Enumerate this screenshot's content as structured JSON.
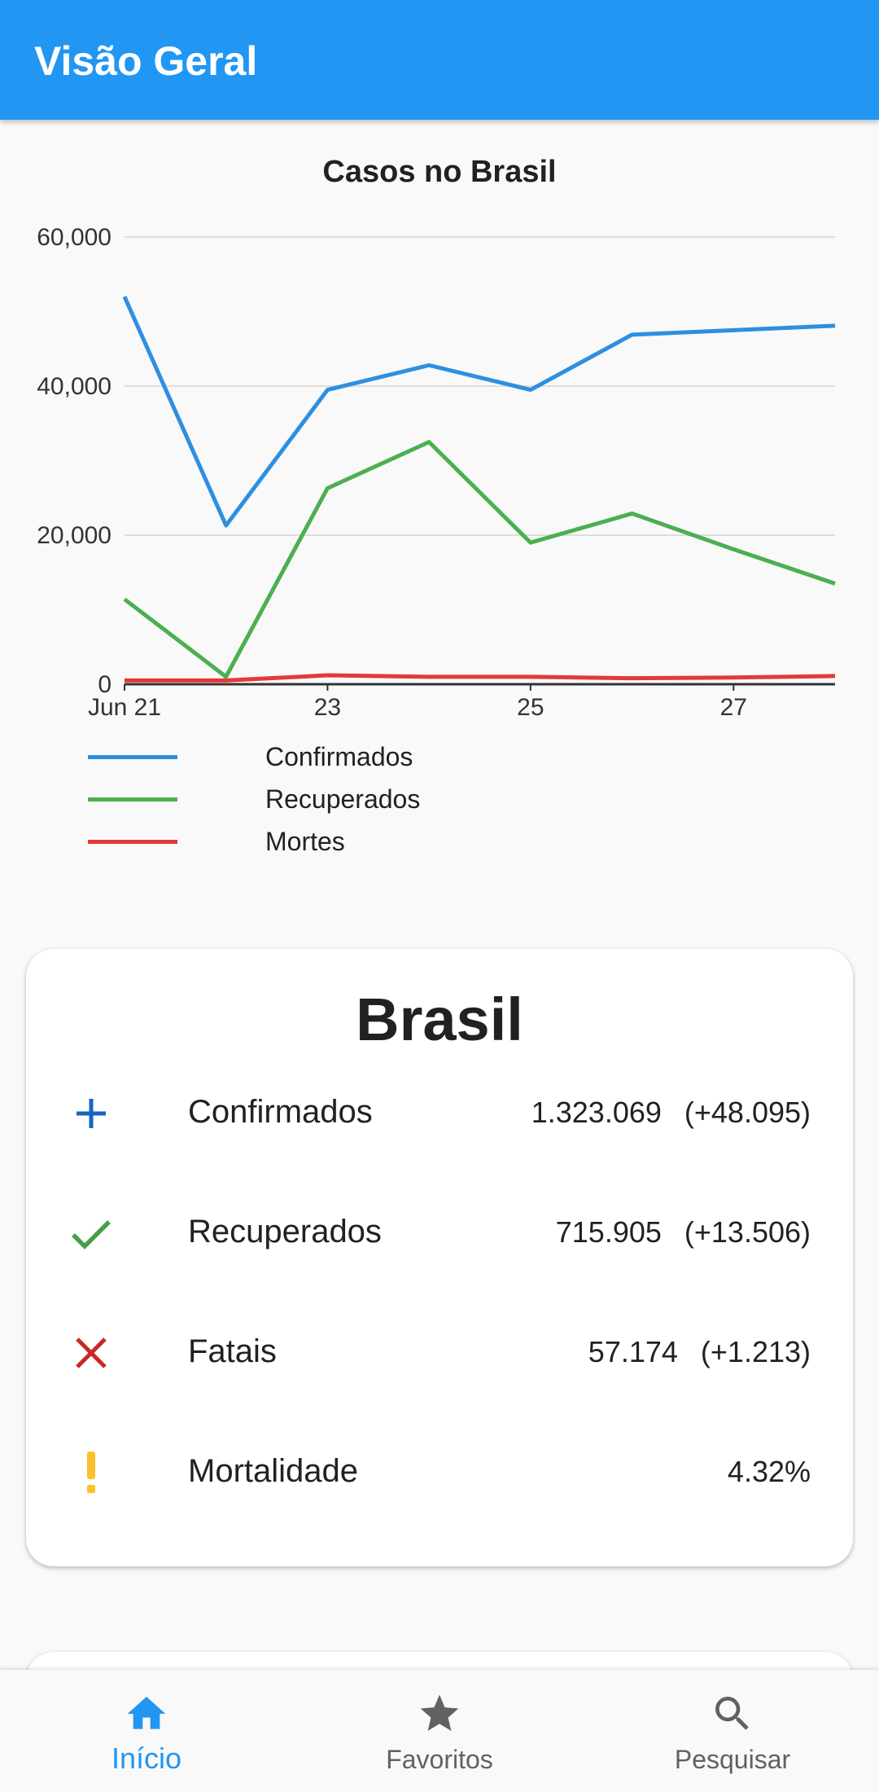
{
  "appbar": {
    "title": "Visão Geral"
  },
  "chart_section": {
    "title": "Casos no Brasil"
  },
  "chart_data": {
    "type": "line",
    "title": "Casos no Brasil",
    "x": [
      "Jun 21",
      "22",
      "23",
      "24",
      "25",
      "26",
      "27",
      "28"
    ],
    "x_tick_labels": [
      "Jun 21",
      "23",
      "25",
      "27"
    ],
    "y_tick_labels": [
      "0",
      "20,000",
      "40,000",
      "60,000"
    ],
    "ylim": [
      0,
      60000
    ],
    "grid": true,
    "legend_position": "bottom",
    "series": [
      {
        "name": "Confirmados",
        "color": "#2e8fe0",
        "values": [
          52000,
          21300,
          39500,
          42800,
          39500,
          46900,
          47500,
          48100
        ]
      },
      {
        "name": "Recuperados",
        "color": "#4caf50",
        "values": [
          11400,
          1000,
          26300,
          32500,
          19000,
          22900,
          18100,
          13500
        ]
      },
      {
        "name": "Mortes",
        "color": "#e53935",
        "values": [
          500,
          500,
          1200,
          1000,
          1000,
          800,
          900,
          1100
        ]
      }
    ]
  },
  "summary": {
    "title": "Brasil",
    "rows": [
      {
        "icon": "plus-icon",
        "color": "#1565c0",
        "label": "Confirmados",
        "value": "1.323.069",
        "delta": "(+48.095)"
      },
      {
        "icon": "check-icon",
        "color": "#43a047",
        "label": "Recuperados",
        "value": "715.905",
        "delta": "(+13.506)"
      },
      {
        "icon": "close-icon",
        "color": "#c62828",
        "label": "Fatais",
        "value": "57.174",
        "delta": "(+1.213)"
      },
      {
        "icon": "exclamation-icon",
        "color": "#fbc02d",
        "label": "Mortalidade",
        "value": "4.32%",
        "delta": ""
      }
    ]
  },
  "bottom_nav": {
    "items": [
      {
        "icon": "home-icon",
        "label": "Início",
        "active": true
      },
      {
        "icon": "star-icon",
        "label": "Favoritos",
        "active": false
      },
      {
        "icon": "search-icon",
        "label": "Pesquisar",
        "active": false
      }
    ],
    "active_color": "#2196f3",
    "inactive_color": "#616161"
  }
}
